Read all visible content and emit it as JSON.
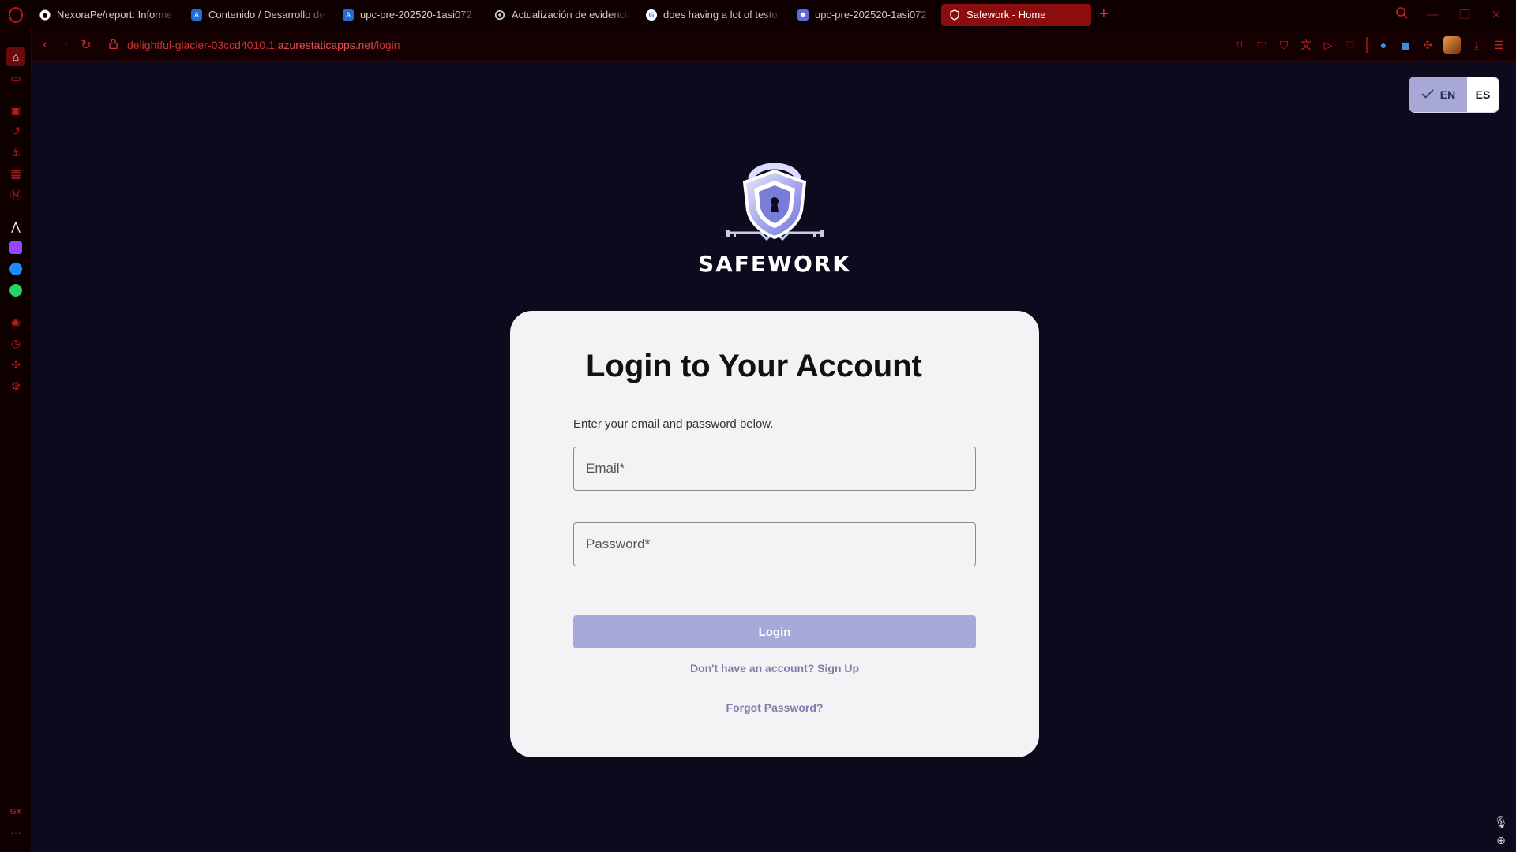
{
  "browser": {
    "tabs": [
      {
        "label": "NexoraPe/report: Informe",
        "favicon": "github-icon",
        "color": "#ffffff"
      },
      {
        "label": "Contenido / Desarrollo de",
        "favicon": "azure-devops-icon",
        "color": "#1f6fd8"
      },
      {
        "label": "upc-pre-202520-1asi072",
        "favicon": "azure-devops-icon",
        "color": "#1f6fd8"
      },
      {
        "label": "Actualización de evidencia",
        "favicon": "openai-icon",
        "color": "#cccccc"
      },
      {
        "label": "does having a lot of testo",
        "favicon": "google-icon",
        "color": "#ffffff"
      },
      {
        "label": "upc-pre-202520-1asi072",
        "favicon": "shield-app-icon",
        "color": "#5a6ae0"
      },
      {
        "label": "Safework - Home",
        "favicon": "safework-icon",
        "color": "#ffffff",
        "active": true
      }
    ],
    "new_tab": "+",
    "url_prefix": "delightful-glacier-03ccd4010.1.",
    "url_domain": "azurestaticapps.net",
    "url_path": "/login"
  },
  "page": {
    "lang": {
      "en": "EN",
      "es": "ES",
      "selected": "EN"
    },
    "brand": "SAFEWORK",
    "card": {
      "title": "Login to Your Account",
      "subtitle": "Enter your email and password below.",
      "email_placeholder": "Email*",
      "password_placeholder": "Password*",
      "login_label": "Login",
      "signup_link": "Don't have an account? Sign Up",
      "forgot_link": "Forgot Password?"
    }
  },
  "colors": {
    "page_bg": "#0c0a1c",
    "card_bg": "#f3f3f6",
    "accent": "#a7a9d8",
    "browser_red": "#c81414"
  },
  "sidebar": {
    "gx_label": "GX",
    "more_label": "···"
  }
}
